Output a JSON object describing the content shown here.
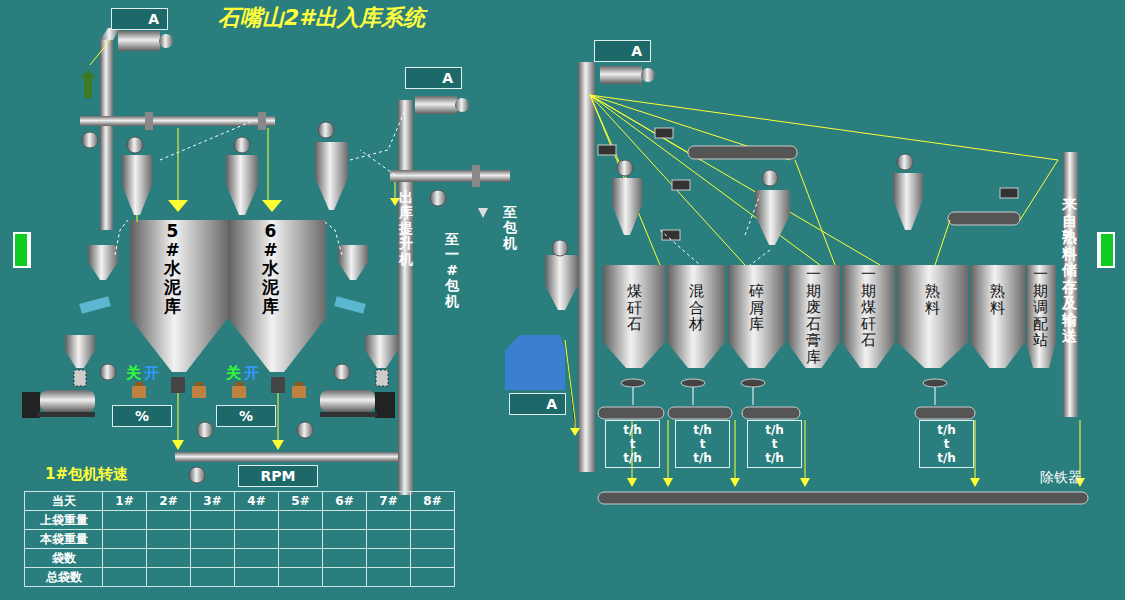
{
  "title": "石嘴山2#出入库系统",
  "ampBoxes": [
    {
      "label": "A"
    },
    {
      "label": "A"
    },
    {
      "label": "A"
    },
    {
      "label": "A"
    }
  ],
  "silos": [
    {
      "label": "5#水泥库"
    },
    {
      "label": "6#水泥库"
    }
  ],
  "elevator": "出库提升机",
  "packerTargets": [
    "至一#包机",
    "至包机"
  ],
  "valves": [
    {
      "close": "关",
      "open": "开",
      "opening": "%"
    },
    {
      "close": "关",
      "open": "开",
      "opening": "%"
    }
  ],
  "rpm": "RPM",
  "packerSpeed": "1#包机转速",
  "table": {
    "columns": [
      "当天",
      "1#",
      "2#",
      "3#",
      "4#",
      "5#",
      "6#",
      "7#",
      "8#"
    ],
    "rows": [
      {
        "label": "上袋重量",
        "cells": [
          "",
          "",
          "",
          "",
          "",
          "",
          "",
          ""
        ]
      },
      {
        "label": "本袋重量",
        "cells": [
          "",
          "",
          "",
          "",
          "",
          "",
          "",
          ""
        ]
      },
      {
        "label": "袋数",
        "cells": [
          "",
          "",
          "",
          "",
          "",
          "",
          "",
          ""
        ]
      },
      {
        "label": "总袋数",
        "cells": [
          "",
          "",
          "",
          "",
          "",
          "",
          "",
          ""
        ]
      }
    ]
  },
  "bins": [
    "煤矸石",
    "混合材",
    "碎屑库",
    "一期废石膏库",
    "一期煤矸石",
    "熟料",
    "熟料",
    "一期调配站"
  ],
  "scales": [
    {
      "lines": [
        "t/h",
        "t",
        "t/h"
      ]
    },
    {
      "lines": [
        "t/h",
        "t",
        "t/h"
      ]
    },
    {
      "lines": [
        "t/h",
        "t",
        "t/h"
      ]
    },
    {
      "lines": [
        "t/h",
        "t",
        "t/h"
      ]
    }
  ],
  "incoming": "来自熟料储存及输送",
  "ironRemover": "除铁器"
}
